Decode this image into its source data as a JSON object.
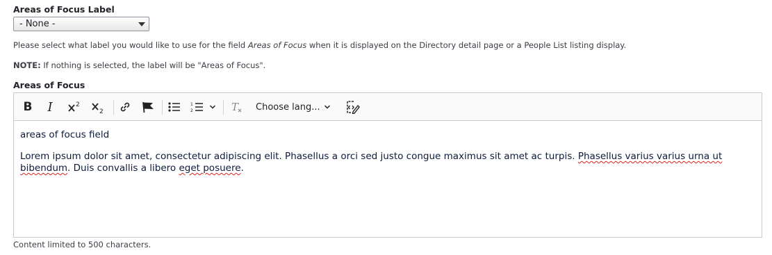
{
  "label_select": {
    "label": "Areas of Focus Label",
    "selected": "- None -"
  },
  "description": {
    "prefix": "Please select what label you would like to use for the field ",
    "field_name": "Areas of Focus",
    "suffix": " when it is displayed on the Directory detail page or a People List listing display."
  },
  "note": {
    "strong": "NOTE:",
    "text": " If nothing is selected, the label will be \"Areas of Focus\"."
  },
  "editor": {
    "label": "Areas of Focus",
    "toolbar": {
      "bold": "B",
      "italic": "I",
      "language": "Choose lang..."
    },
    "content": {
      "p1": "areas of focus field",
      "p2_a": "Lorem ipsum dolor sit amet, consectetur adipiscing elit. Phasellus a orci sed justo congue maximus sit amet ac turpis. ",
      "p2_spell1": "Phasellus varius varius urna ut",
      "p2_line2_a": "bibendum",
      "p2_line2_b": ". Duis convallis a libero ",
      "p2_spell2": "eget posuere",
      "p2_end": "."
    },
    "limit": "Content limited to 500 characters."
  }
}
